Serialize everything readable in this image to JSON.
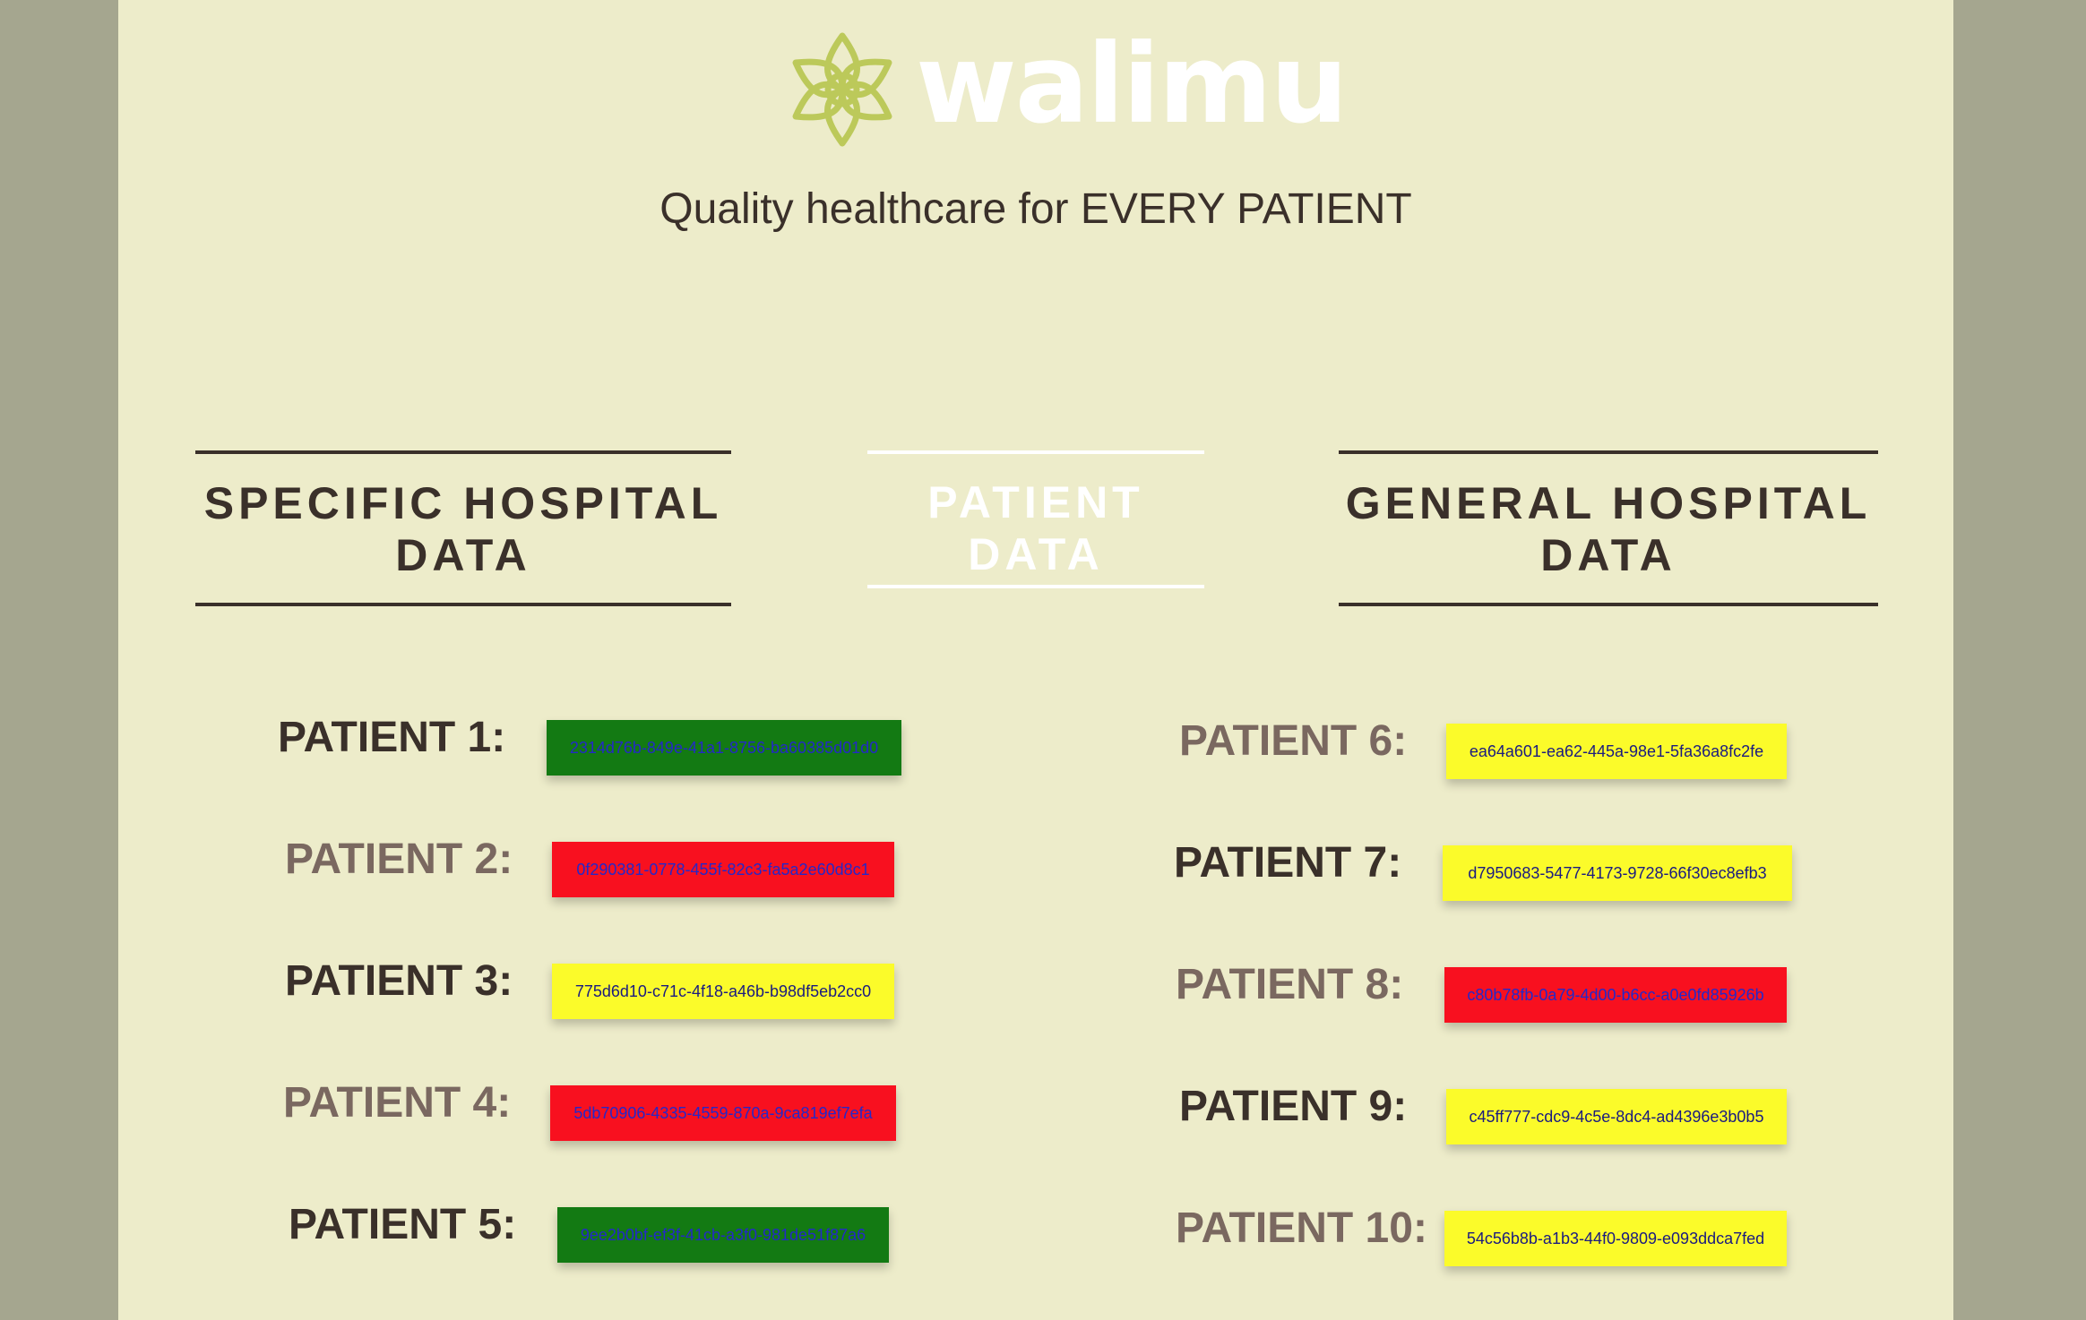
{
  "brand": {
    "name": "walimu",
    "tagline": "Quality healthcare for EVERY PATIENT",
    "logo_icon": "flower-star-icon",
    "logo_color": "#bcc95a"
  },
  "nav": {
    "specific_line1": "SPECIFIC HOSPITAL",
    "specific_line2": "DATA",
    "patient": "PATIENT DATA",
    "general_line1": "GENERAL HOSPITAL",
    "general_line2": "DATA"
  },
  "colors": {
    "green": "#137a13",
    "red": "#f8101f",
    "yellow": "#fbfb2a",
    "id_text_blue": "#2428c8",
    "id_text_navy": "#1a1a80"
  },
  "patients": [
    {
      "label": "PATIENT 1:",
      "id": "2314d76b-849e-41a1-8756-ba60385d01d0",
      "status": "green"
    },
    {
      "label": "PATIENT 2:",
      "id": "0f290381-0778-455f-82c3-fa5a2e60d8c1",
      "status": "red"
    },
    {
      "label": "PATIENT 3:",
      "id": "775d6d10-c71c-4f18-a46b-b98df5eb2cc0",
      "status": "yellow"
    },
    {
      "label": "PATIENT 4:",
      "id": "5db70906-4335-4559-870a-9ca819ef7efa",
      "status": "red"
    },
    {
      "label": "PATIENT 5:",
      "id": "9ee2b0bf-ef3f-41cb-a3f0-981de51f87a6",
      "status": "green"
    },
    {
      "label": "PATIENT 6:",
      "id": "ea64a601-ea62-445a-98e1-5fa36a8fc2fe",
      "status": "yellow"
    },
    {
      "label": "PATIENT 7:",
      "id": "d7950683-5477-4173-9728-66f30ec8efb3",
      "status": "yellow"
    },
    {
      "label": "PATIENT 8:",
      "id": "c80b78fb-0a79-4d00-b6cc-a0e0fd85926b",
      "status": "red"
    },
    {
      "label": "PATIENT 9:",
      "id": "c45ff777-cdc9-4c5e-8dc4-ad4396e3b0b5",
      "status": "yellow"
    },
    {
      "label": "PATIENT 10:",
      "id": "54c56b8b-a1b3-44f0-9809-e093ddca7fed",
      "status": "yellow"
    }
  ]
}
